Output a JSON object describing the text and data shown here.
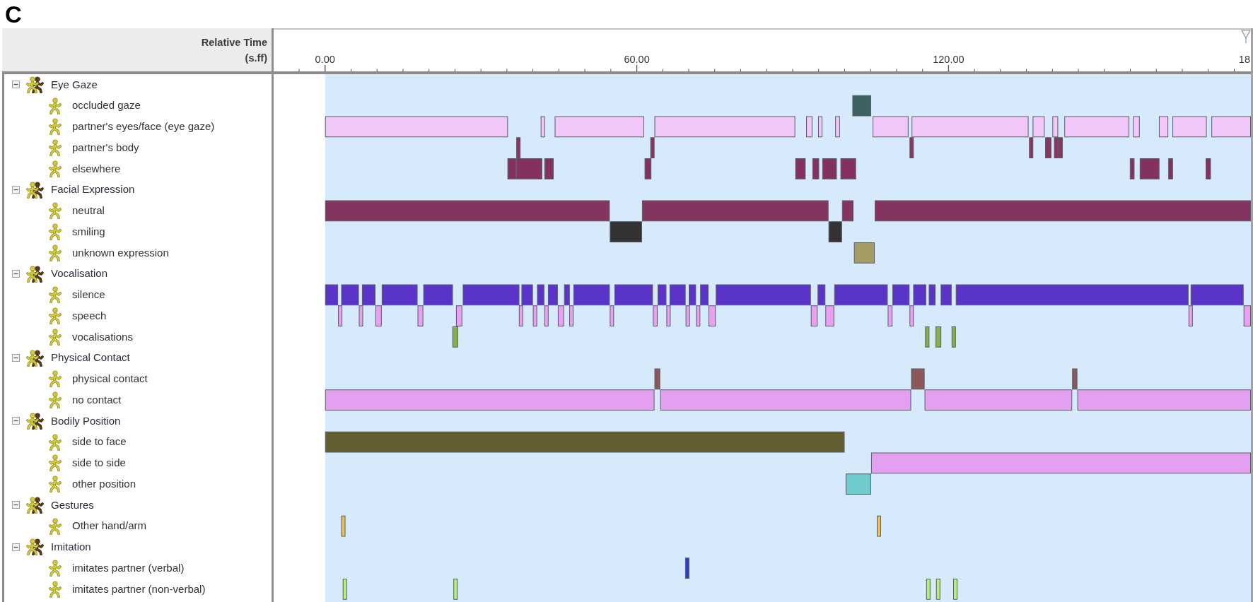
{
  "figure_label": "C",
  "header": {
    "title": "Relative Time",
    "unit": "(s.ff)"
  },
  "ruler": {
    "ticks": [
      "0.00",
      "60.00",
      "120.00",
      "18"
    ]
  },
  "tree": [
    {
      "label": "Eye Gaze",
      "expanded": true,
      "children": [
        {
          "label": "occluded gaze",
          "color": "#3e6161"
        },
        {
          "label": "partner's eyes/face (eye gaze)",
          "color": "#f2c8fa"
        },
        {
          "label": "partner's body",
          "color": "#8a3560"
        },
        {
          "label": "elsewhere",
          "color": "#85315f"
        }
      ]
    },
    {
      "label": "Facial Expression",
      "expanded": true,
      "children": [
        {
          "label": "neutral",
          "color": "#85335f"
        },
        {
          "label": "smiling",
          "color": "#333333"
        },
        {
          "label": "unknown expression",
          "color": "#a39c64"
        }
      ]
    },
    {
      "label": "Vocalisation",
      "expanded": true,
      "children": [
        {
          "label": "silence",
          "color": "#5a34c8"
        },
        {
          "label": "speech",
          "color": "#e8a0f0"
        },
        {
          "label": "vocalisations",
          "color": "#86b04a"
        }
      ]
    },
    {
      "label": "Physical Contact",
      "expanded": true,
      "children": [
        {
          "label": "physical contact",
          "color": "#8a5858"
        },
        {
          "label": "no contact",
          "color": "#e4a0f0"
        }
      ]
    },
    {
      "label": "Bodily Position",
      "expanded": true,
      "children": [
        {
          "label": "side to face",
          "color": "#645f33"
        },
        {
          "label": "side to side",
          "color": "#e4a0f0"
        },
        {
          "label": "other position",
          "color": "#70cccc"
        }
      ]
    },
    {
      "label": "Gestures",
      "expanded": true,
      "children": [
        {
          "label": "Other hand/arm",
          "color": "#e8c054"
        }
      ]
    },
    {
      "label": "Imitation",
      "expanded": true,
      "children": [
        {
          "label": "imitates partner (verbal)",
          "color": "#2a3ec8"
        },
        {
          "label": "imitates partner (non-verbal)",
          "color": "#b4f078"
        }
      ]
    }
  ]
}
